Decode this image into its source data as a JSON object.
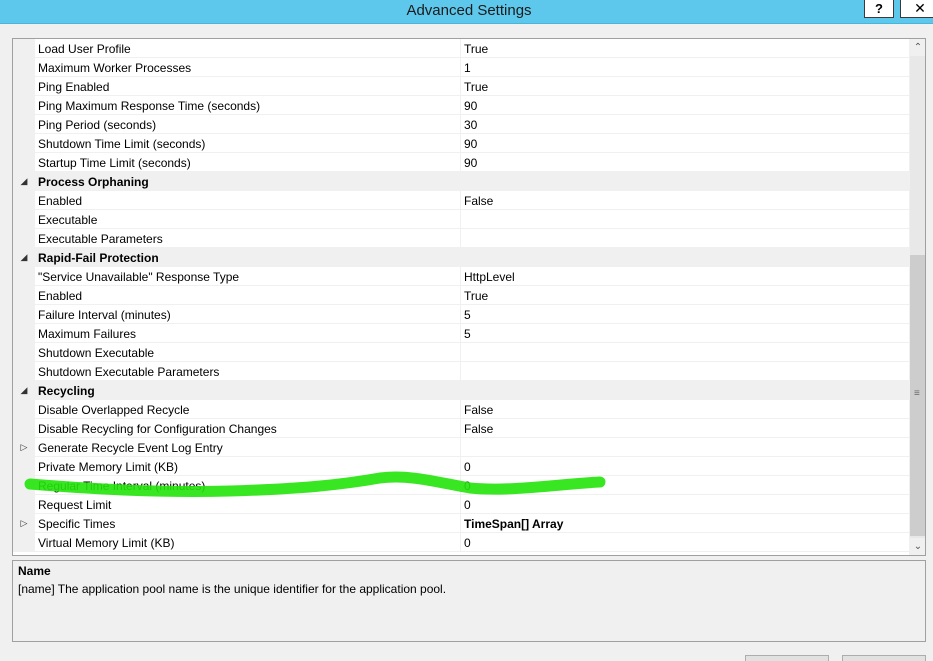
{
  "window": {
    "title": "Advanced Settings",
    "help_label": "?",
    "close_label": "✕"
  },
  "rows": [
    {
      "type": "prop",
      "name": "Load User Profile",
      "value": "True"
    },
    {
      "type": "prop",
      "name": "Maximum Worker Processes",
      "value": "1"
    },
    {
      "type": "prop",
      "name": "Ping Enabled",
      "value": "True"
    },
    {
      "type": "prop",
      "name": "Ping Maximum Response Time (seconds)",
      "value": "90"
    },
    {
      "type": "prop",
      "name": "Ping Period (seconds)",
      "value": "30"
    },
    {
      "type": "prop",
      "name": "Shutdown Time Limit (seconds)",
      "value": "90"
    },
    {
      "type": "prop",
      "name": "Startup Time Limit (seconds)",
      "value": "90"
    },
    {
      "type": "category",
      "name": "Process Orphaning",
      "expander": "collapse"
    },
    {
      "type": "prop",
      "name": "Enabled",
      "value": "False"
    },
    {
      "type": "prop",
      "name": "Executable",
      "value": ""
    },
    {
      "type": "prop",
      "name": "Executable Parameters",
      "value": ""
    },
    {
      "type": "category",
      "name": "Rapid-Fail Protection",
      "expander": "collapse"
    },
    {
      "type": "prop",
      "name": "\"Service Unavailable\" Response Type",
      "value": "HttpLevel"
    },
    {
      "type": "prop",
      "name": "Enabled",
      "value": "True"
    },
    {
      "type": "prop",
      "name": "Failure Interval (minutes)",
      "value": "5"
    },
    {
      "type": "prop",
      "name": "Maximum Failures",
      "value": "5"
    },
    {
      "type": "prop",
      "name": "Shutdown Executable",
      "value": ""
    },
    {
      "type": "prop",
      "name": "Shutdown Executable Parameters",
      "value": ""
    },
    {
      "type": "category",
      "name": "Recycling",
      "expander": "collapse"
    },
    {
      "type": "prop",
      "name": "Disable Overlapped Recycle",
      "value": "False"
    },
    {
      "type": "prop",
      "name": "Disable Recycling for Configuration Changes",
      "value": "False"
    },
    {
      "type": "prop",
      "name": "Generate Recycle Event Log Entry",
      "value": "",
      "expander": "expand"
    },
    {
      "type": "prop",
      "name": "Private Memory Limit (KB)",
      "value": "0"
    },
    {
      "type": "prop",
      "name": "Regular Time Interval (minutes)",
      "value": "0"
    },
    {
      "type": "prop",
      "name": "Request Limit",
      "value": "0"
    },
    {
      "type": "prop",
      "name": "Specific Times",
      "value": "TimeSpan[] Array",
      "expander": "expand",
      "value_bold": true
    },
    {
      "type": "prop",
      "name": "Virtual Memory Limit (KB)",
      "value": "0"
    }
  ],
  "icons": {
    "collapse": "◢",
    "expand": "▷",
    "scroll_up": "⌃",
    "scroll_down": "⌄",
    "grip": "≡"
  },
  "description": {
    "title": "Name",
    "text": "[name] The application pool name is the unique identifier for the application pool."
  },
  "colors": {
    "titlebar": "#5ec8ec",
    "highlighter": "#22e30a"
  }
}
